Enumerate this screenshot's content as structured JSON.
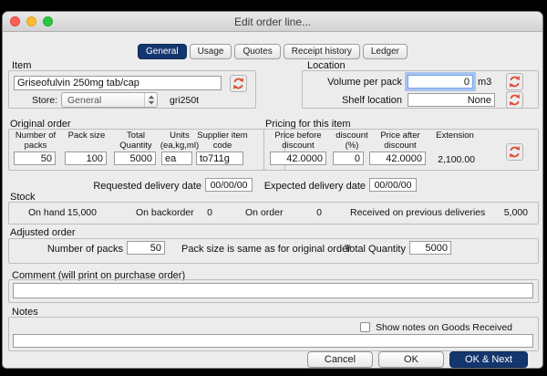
{
  "colors": {
    "accent": "#14366e",
    "refresh_icon": "#e0492f"
  },
  "window_title": "Edit order line...",
  "tabs": [
    "General",
    "Usage",
    "Quotes",
    "Receipt history",
    "Ledger"
  ],
  "item": {
    "label": "Item",
    "name": "Griseofulvin 250mg tab/cap",
    "store_label": "Store:",
    "store_value": "General",
    "item_code": "gri250t"
  },
  "location": {
    "label": "Location",
    "volume_label": "Volume per pack",
    "volume_value": "0",
    "volume_unit": "m3",
    "shelf_label": "Shelf location",
    "shelf_value": "None"
  },
  "original_order": {
    "label": "Original order",
    "headers": {
      "packs": "Number of packs",
      "pack_size": "Pack size",
      "total_qty": "Total Quantity",
      "units": "Units (ea,kg,ml)",
      "supplier_code": "Supplier item code"
    },
    "values": {
      "packs": "50",
      "pack_size": "100",
      "total_qty": "5000",
      "units": "ea",
      "supplier_code": "to711g"
    },
    "requested_date_label": "Requested delivery date",
    "requested_date_value": "00/00/00"
  },
  "pricing": {
    "label": "Pricing for this item",
    "headers": {
      "before": "Price before discount",
      "discount": "discount (%)",
      "after": "Price after discount",
      "extension": "Extension"
    },
    "values": {
      "before": "42.0000",
      "discount": "0",
      "after": "42.0000",
      "extension": "2,100.00"
    },
    "expected_date_label": "Expected delivery date",
    "expected_date_value": "00/00/00"
  },
  "stock": {
    "label": "Stock",
    "on_hand_label": "On hand",
    "on_hand_value": "15,000",
    "backorder_label": "On backorder",
    "backorder_value": "0",
    "on_order_label": "On order",
    "on_order_value": "0",
    "received_label": "Received on previous deliveries",
    "received_value": "5,000"
  },
  "adjusted": {
    "label": "Adjusted order",
    "packs_label": "Number of packs",
    "packs_value": "50",
    "note": "Pack size is same as for original order",
    "total_label": "Total Quantity",
    "total_value": "5000"
  },
  "comment": {
    "label": "Comment (will print on purchase order)",
    "value": ""
  },
  "notes": {
    "label": "Notes",
    "value": "",
    "checkbox_label": "Show notes on Goods Received"
  },
  "buttons": {
    "cancel": "Cancel",
    "ok": "OK",
    "ok_next": "OK & Next"
  }
}
